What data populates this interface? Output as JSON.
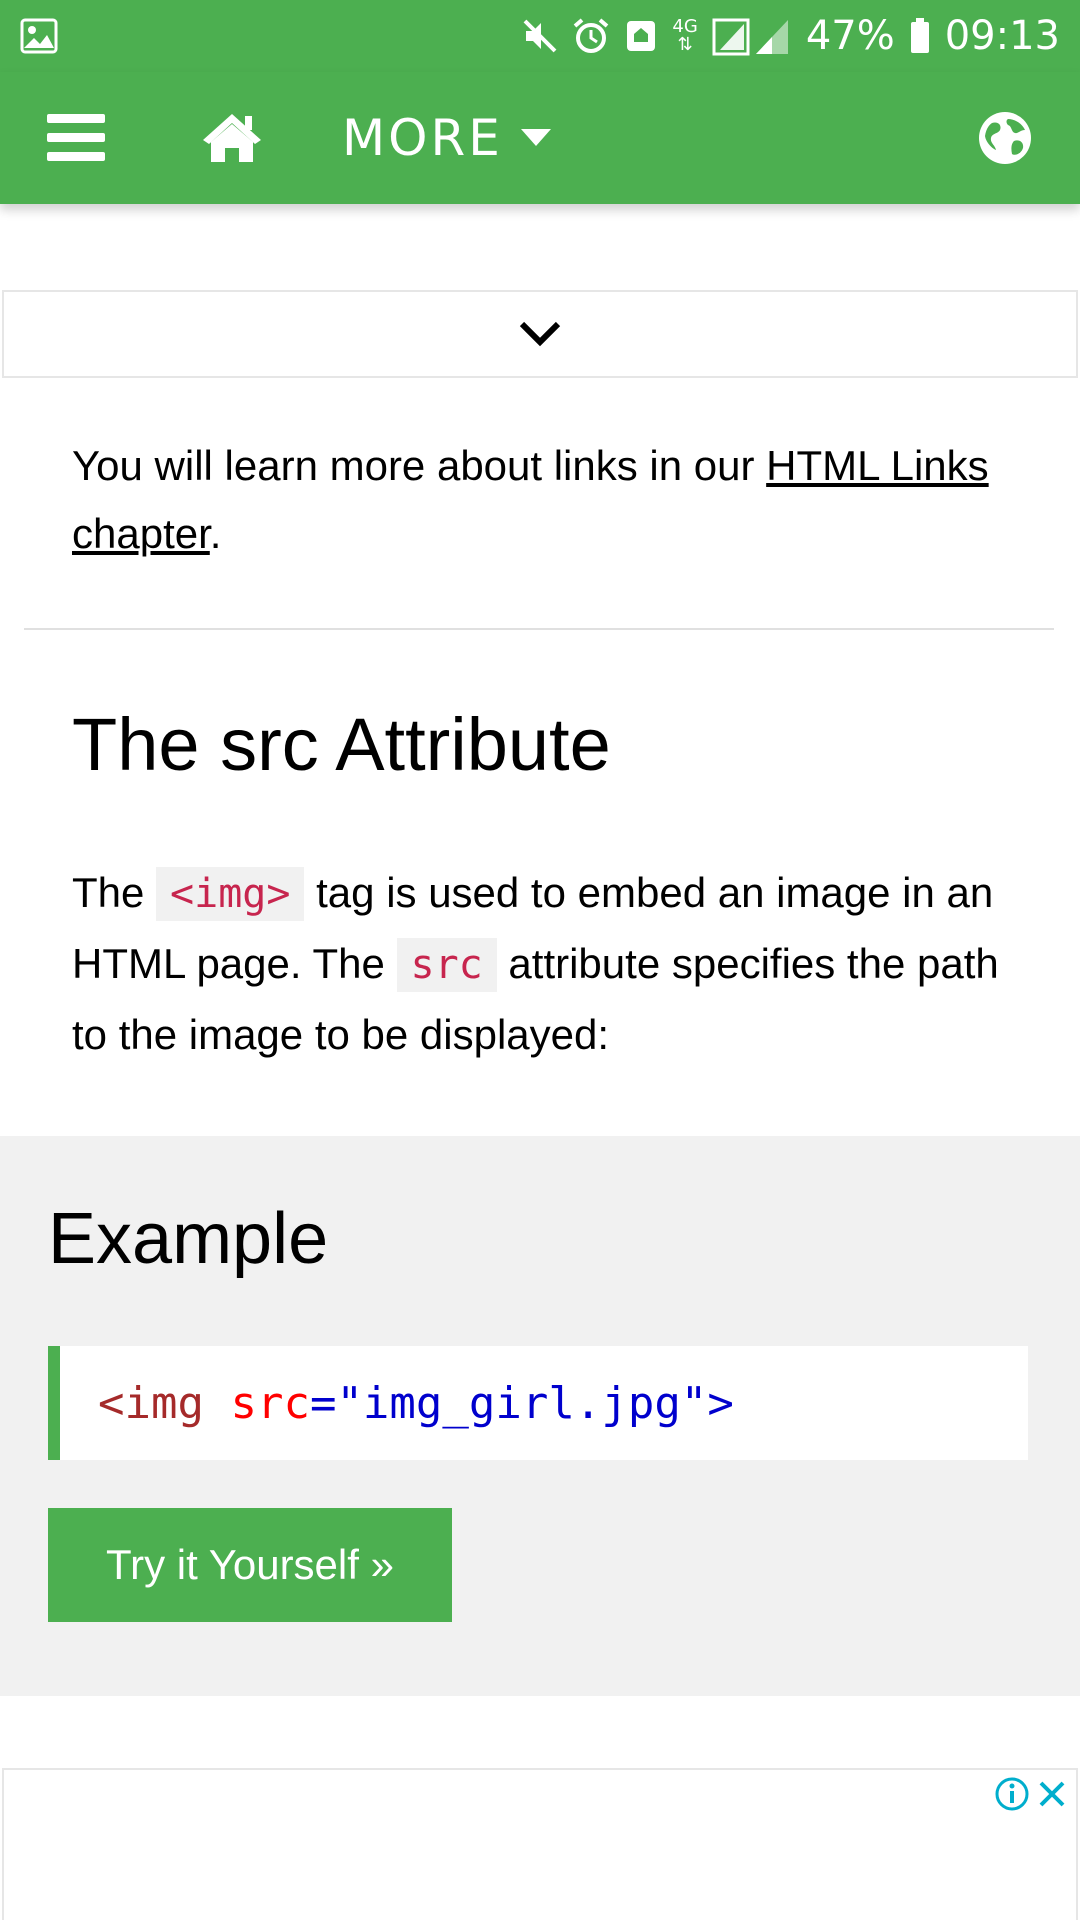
{
  "status_bar": {
    "battery": "47%",
    "time": "09:13",
    "network": "4G",
    "icons": [
      "gallery-icon",
      "mute-icon",
      "alarm-icon",
      "nfc-icon",
      "signal-icon",
      "battery-icon"
    ]
  },
  "nav": {
    "more_label": "MORE",
    "icons": [
      "menu-icon",
      "home-icon",
      "caret-down-icon",
      "globe-icon"
    ]
  },
  "content": {
    "para1_text": "You will learn more about links in our ",
    "para1_link": "HTML Links chapter",
    "para1_end": ".",
    "heading": "The src Attribute",
    "para2_a": "The ",
    "para2_code1": "<img>",
    "para2_b": " tag is used to embed an image in an HTML page. The ",
    "para2_code2": "src",
    "para2_c": " attribute specifies the path to the image to be displayed:"
  },
  "example": {
    "title": "Example",
    "code_tag_open": "<img",
    "code_attr": " src",
    "code_eq": "=",
    "code_value": "\"img_girl.jpg\"",
    "code_tag_close": ">",
    "try_button": "Try it Yourself »"
  },
  "ad": {
    "icons": [
      "info-icon",
      "close-icon"
    ]
  },
  "colors": {
    "brand_green": "#4caf50",
    "code_red": "#c7254e",
    "code_bg": "#f1f1f1"
  }
}
